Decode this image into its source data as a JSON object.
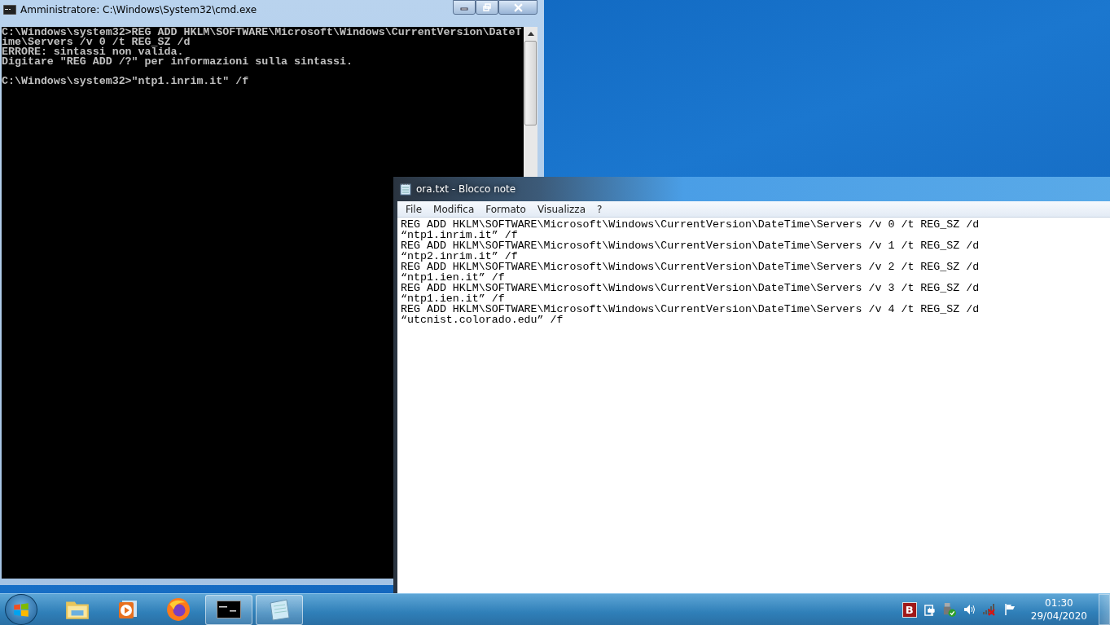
{
  "cmd_window": {
    "title": "Amministratore: C:\\Windows\\System32\\cmd.exe",
    "blocks": [
      [
        "C:\\Windows\\system32>REG ADD HKLM\\SOFTWARE\\Microsoft\\Windows\\CurrentVersion\\DateT",
        "ime\\Servers /v 0 /t REG_SZ /d",
        "ERRORE: sintassi non valida.",
        "Digitare \"REG ADD /?\" per informazioni sulla sintassi."
      ],
      [
        "C:\\Windows\\system32>\"ntp1.inrim.it\" /f"
      ]
    ]
  },
  "notepad_window": {
    "title": "ora.txt - Blocco note",
    "menu": [
      "File",
      "Modifica",
      "Formato",
      "Visualizza",
      "?"
    ],
    "lines": [
      "REG ADD HKLM\\SOFTWARE\\Microsoft\\Windows\\CurrentVersion\\DateTime\\Servers /v 0 /t REG_SZ /d",
      "“ntp1.inrim.it” /f",
      "REG ADD HKLM\\SOFTWARE\\Microsoft\\Windows\\CurrentVersion\\DateTime\\Servers /v 1 /t REG_SZ /d",
      "“ntp2.inrim.it” /f",
      "REG ADD HKLM\\SOFTWARE\\Microsoft\\Windows\\CurrentVersion\\DateTime\\Servers /v 2 /t REG_SZ /d",
      "“ntp1.ien.it” /f",
      "REG ADD HKLM\\SOFTWARE\\Microsoft\\Windows\\CurrentVersion\\DateTime\\Servers /v 3 /t REG_SZ /d",
      "“ntp1.ien.it” /f",
      "REG ADD HKLM\\SOFTWARE\\Microsoft\\Windows\\CurrentVersion\\DateTime\\Servers /v 4 /t REG_SZ /d",
      "“utcnist.colorado.edu” /f"
    ]
  },
  "taskbar": {
    "items": [
      {
        "kind": "explorer",
        "running": false
      },
      {
        "kind": "media",
        "running": false
      },
      {
        "kind": "browser",
        "running": false
      },
      {
        "kind": "terminal",
        "running": true
      },
      {
        "kind": "notepad",
        "running": true
      }
    ],
    "tray": [
      {
        "kind": "badge",
        "label": "B"
      },
      {
        "kind": "power"
      },
      {
        "kind": "usb"
      },
      {
        "kind": "volume"
      },
      {
        "kind": "network"
      },
      {
        "kind": "flag"
      }
    ],
    "time": "01:30",
    "date": "29/04/2020"
  }
}
